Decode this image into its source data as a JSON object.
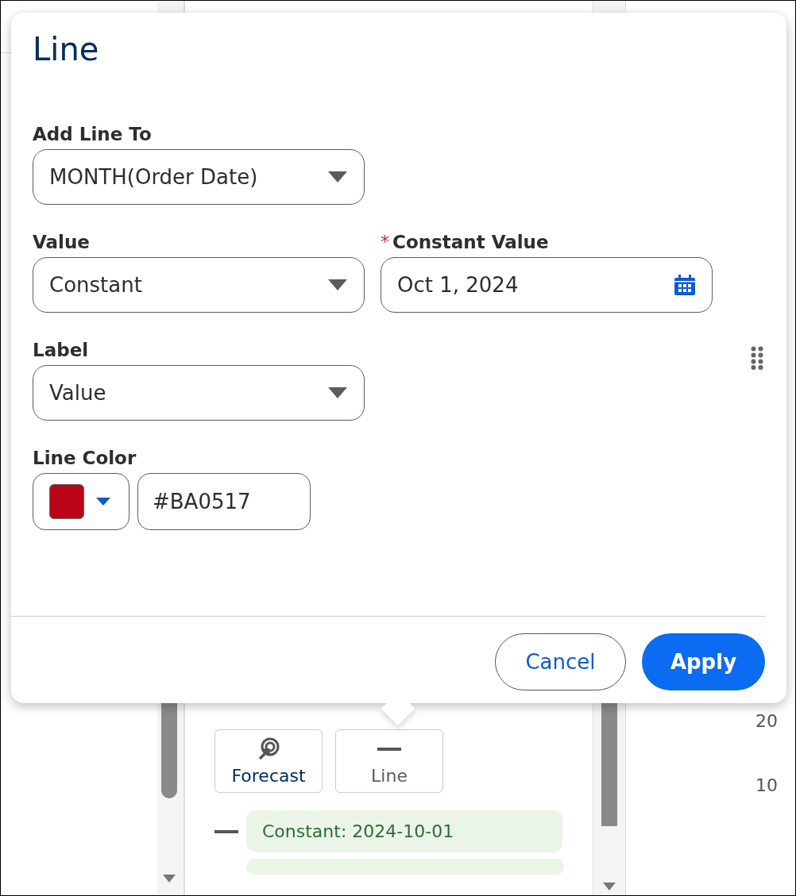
{
  "dialog": {
    "title": "Line",
    "add_line_to": {
      "label": "Add Line To",
      "value": "MONTH(Order Date)"
    },
    "value": {
      "label": "Value",
      "value": "Constant"
    },
    "constant_value": {
      "required_mark": "*",
      "label": "Constant Value",
      "value": "Oct 1, 2024"
    },
    "label": {
      "label": "Label",
      "value": "Value"
    },
    "line_color": {
      "label": "Line Color",
      "color": "#ba0517",
      "hex": "#BA0517"
    },
    "buttons": [
      {
        "label": "Cancel",
        "kind": "neutral"
      },
      {
        "label": "Apply",
        "kind": "brand"
      }
    ]
  },
  "analytics_panel": {
    "items": [
      {
        "label": "Forecast",
        "kind": "forecast"
      },
      {
        "label": "Line",
        "kind": "line"
      }
    ],
    "lines": [
      {
        "label": "Constant: 2024-10-01"
      }
    ]
  },
  "axis_ticks": [
    "20",
    "10"
  ]
}
